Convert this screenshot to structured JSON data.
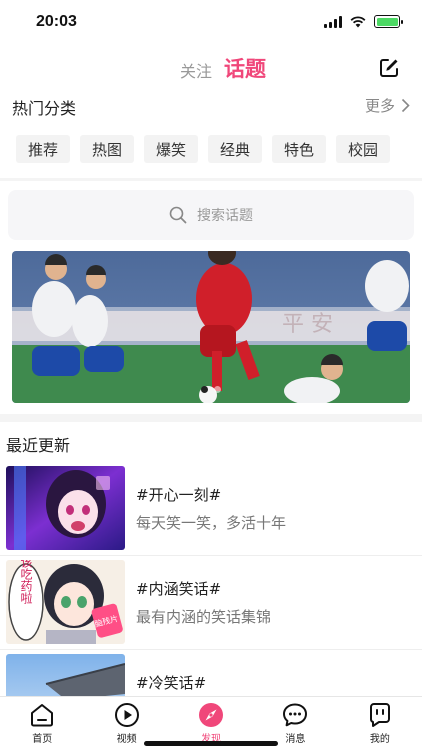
{
  "status_bar": {
    "time": "20:03",
    "battery_color": "#4cd964"
  },
  "header": {
    "tabs": [
      {
        "label": "关注",
        "active": false
      },
      {
        "label": "话题",
        "active": true
      }
    ],
    "accent": "#f0477a",
    "edit_icon": "edit-icon"
  },
  "hot_categories": {
    "title": "热门分类",
    "more_label": "更多",
    "chips": [
      "推荐",
      "热图",
      "爆笑",
      "经典",
      "特色",
      "校园"
    ]
  },
  "search": {
    "placeholder": "搜索话题",
    "icon": "search-icon"
  },
  "banner": {
    "image": "football-match-photo",
    "dots": 2,
    "active_dot": 0
  },
  "recent": {
    "title": "最近更新",
    "items": [
      {
        "title": "#开心一刻#",
        "desc": "每天笑一笑，多活十年",
        "thumb": "anime-girl-purple"
      },
      {
        "title": "#内涵笑话#",
        "desc": "最有内涵的笑话集锦",
        "thumb": "anime-girl-medicine"
      },
      {
        "title": "#冷笑话#",
        "desc": "",
        "thumb": "stadium-sky"
      }
    ],
    "thumb_text": {
      "bubble": "该吃药啦",
      "bottle": "脑残片"
    }
  },
  "tabbar": {
    "items": [
      {
        "label": "首页",
        "icon": "home-icon"
      },
      {
        "label": "视频",
        "icon": "play-icon"
      },
      {
        "label": "发现",
        "icon": "compass-icon",
        "active": true
      },
      {
        "label": "消息",
        "icon": "chat-icon"
      },
      {
        "label": "我的",
        "icon": "profile-icon"
      }
    ]
  }
}
